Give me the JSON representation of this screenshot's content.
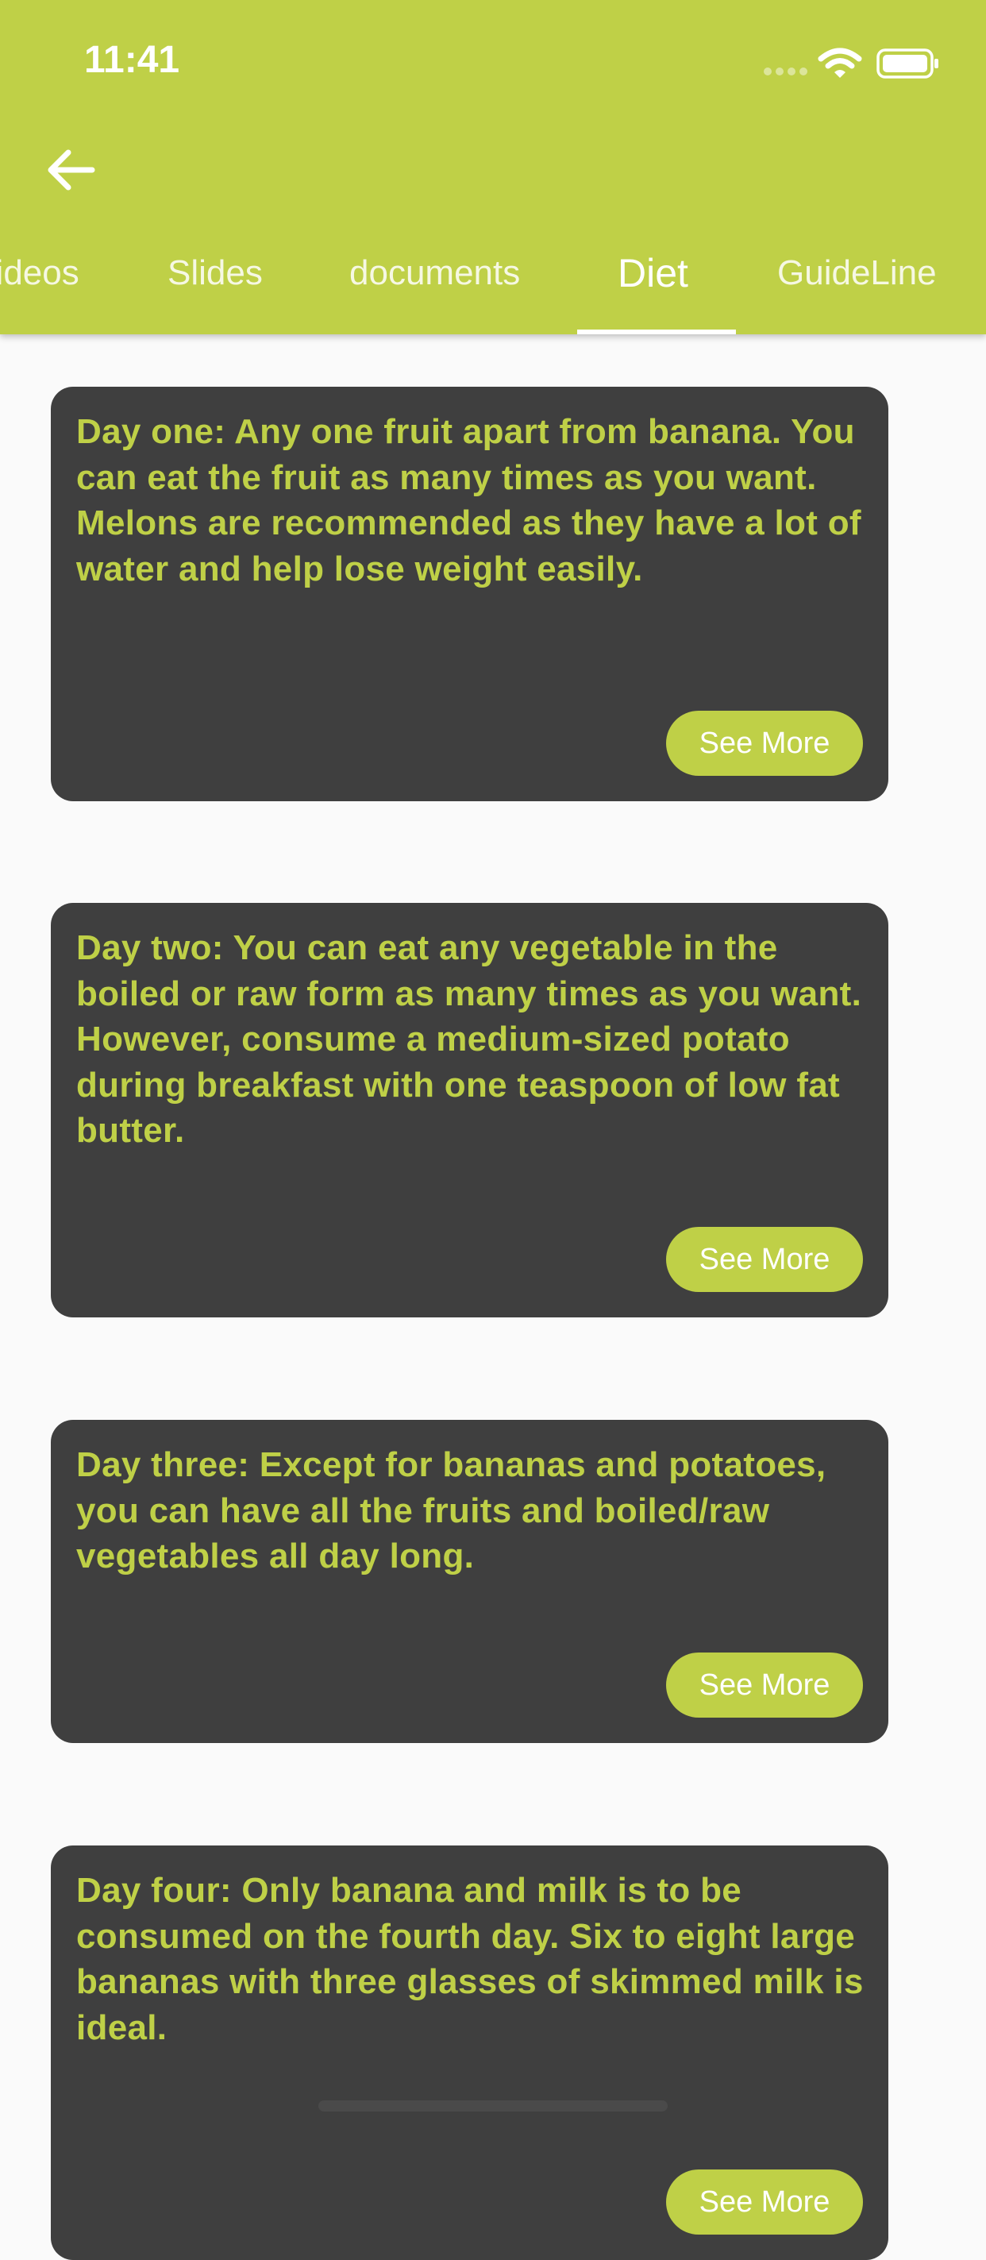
{
  "status_bar": {
    "time": "11:41"
  },
  "tabs": [
    {
      "label": "Videos"
    },
    {
      "label": "Slides"
    },
    {
      "label": "documents"
    },
    {
      "label": "Diet",
      "active": true
    },
    {
      "label": "GuideLine"
    }
  ],
  "cards": [
    {
      "text": "Day one: Any one fruit apart from banana. You can eat the fruit as many times as you want. Melons are recommended as they have a lot of water and help lose weight easily.",
      "button": "See More"
    },
    {
      "text": "Day two: You can eat any vegetable in the boiled or raw form as many times as you want. However, consume a medium-sized potato during breakfast with one teaspoon of low fat butter.",
      "button": "See More"
    },
    {
      "text": "Day three: Except for bananas and potatoes, you can have all the fruits and boiled/raw vegetables all day long.",
      "button": "See More"
    },
    {
      "text": "Day four: Only banana and milk is to be consumed on the fourth day. Six to eight large bananas with three glasses of skimmed milk is ideal.",
      "button": "See More"
    }
  ],
  "colors": {
    "accent": "#BFD047",
    "card_bg": "#3F3F3F",
    "page_bg": "#FAFAFA"
  },
  "icons": [
    "back-arrow-icon",
    "signal-icon",
    "wifi-icon",
    "battery-icon"
  ]
}
